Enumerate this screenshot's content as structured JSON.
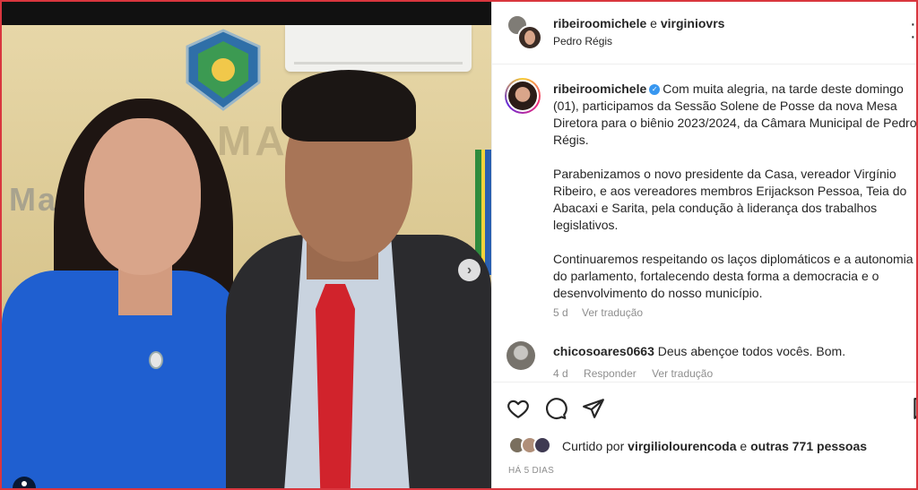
{
  "header": {
    "user1": "ribeiroomichele",
    "and": "e",
    "user2": "virginiovrs",
    "location": "Pedro Régis",
    "more_icon": "more-options-icon"
  },
  "photo": {
    "wall_text_top": "MARÁ",
    "wall_text_bottom": "Ma    al da",
    "next_icon": "chevron-right-icon"
  },
  "caption": {
    "author": "ribeiroomichele",
    "paragraph1": "Com muita alegria, na tarde deste domingo (01), participamos da Sessão Solene de Posse da nova Mesa Diretora para o biênio 2023/2024, da Câmara Municipal de Pedro Régis.",
    "paragraph2": "Parabenizamos o novo presidente da Casa, vereador Virgínio Ribeiro, e aos vereadores membros Erijackson Pessoa, Teia do Abacaxi e Sarita, pela condução à liderança dos trabalhos legislativos.",
    "paragraph3": "Continuaremos respeitando os laços diplomáticos e a autonomia do parlamento, fortalecendo desta forma a democracia e o desenvolvimento do nosso município.",
    "age": "5 d",
    "translate": "Ver tradução"
  },
  "comment": {
    "author": "chicosoares0663",
    "text": "Deus abençoe todos vocês. Bom.",
    "age": "4 d",
    "reply": "Responder",
    "translate": "Ver tradução"
  },
  "actions": {
    "icons": [
      "heart-icon",
      "comment-icon",
      "share-icon",
      "save-icon"
    ]
  },
  "likes": {
    "prefix": "Curtido por",
    "user": "virgiliolourencoda",
    "joiner": "e",
    "others": "outras 771 pessoas"
  },
  "post_date": "HÁ 5 DIAS",
  "colors": {
    "frame_border": "#d9363e",
    "verified": "#3897f0",
    "muted": "#8e8e8e"
  }
}
